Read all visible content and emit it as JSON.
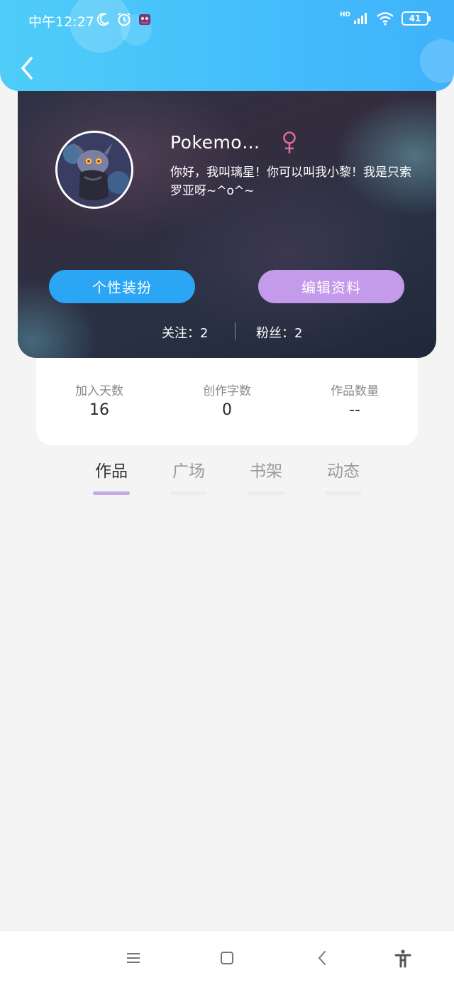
{
  "status_bar": {
    "time": "中午12:27",
    "battery": "41",
    "network": "HD"
  },
  "header": {
    "back_icon": "chevron-left-icon"
  },
  "profile": {
    "username": "Pokemo…",
    "gender": "female",
    "bio": "你好，我叫璃星！你可以叫我小黎！我是只索罗亚呀~^o^~",
    "decorate_button": "个性装扮",
    "edit_button": "编辑资料",
    "following_label": "关注：2",
    "fans_label": "粉丝：2",
    "colors": {
      "decorate_button": "#2aa6f5",
      "edit_button": "#c49bea",
      "header": "#44bdfb"
    }
  },
  "stats": [
    {
      "label": "加入天数",
      "value": "16"
    },
    {
      "label": "创作字数",
      "value": "0"
    },
    {
      "label": "作品数量",
      "value": "--"
    }
  ],
  "tabs": [
    {
      "label": "作品",
      "active": true
    },
    {
      "label": "广场",
      "active": false
    },
    {
      "label": "书架",
      "active": false
    },
    {
      "label": "动态",
      "active": false
    }
  ],
  "nav": {
    "menu_icon": "menu-icon",
    "home_icon": "square-icon",
    "back_icon": "back-triangle-icon",
    "accessibility_icon": "accessibility-icon"
  }
}
